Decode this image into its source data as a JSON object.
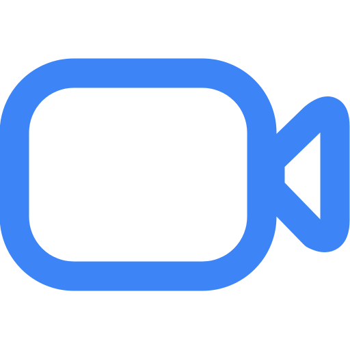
{
  "icon": {
    "name": "video-camera-icon",
    "color": "#3d84f7",
    "background": "#ffffff"
  }
}
